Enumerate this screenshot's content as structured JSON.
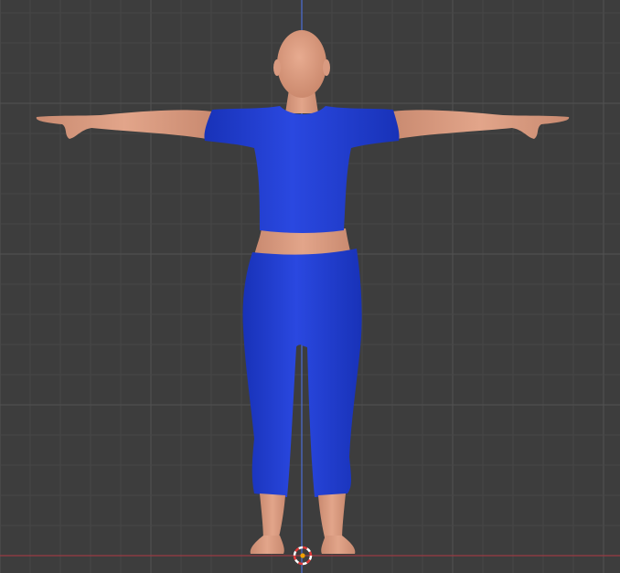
{
  "viewport": {
    "background_color": "#3d3d3d",
    "grid": true,
    "grid_minor_color": "#474747",
    "grid_major_color": "#525252",
    "axis_x_color": "#9a3b44",
    "axis_z_color": "#4c6fd6"
  },
  "scene": {
    "model": {
      "pose": "T-pose",
      "skin_color": "#d99a80",
      "shirt_color": "#1f3dd1",
      "pants_color": "#1f3dd1"
    },
    "cursor": {
      "icon": "3d-cursor-icon",
      "ring_color_a": "#ffffff",
      "ring_color_b": "#e03a3a",
      "center_color": "#f0a000"
    }
  }
}
